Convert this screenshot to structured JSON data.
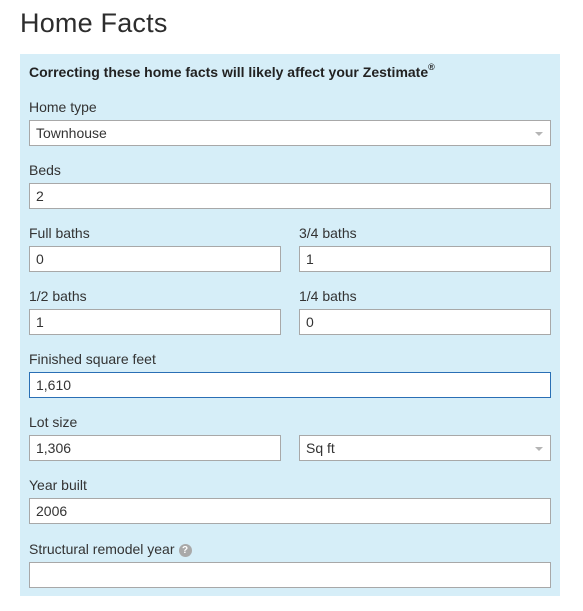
{
  "title": "Home Facts",
  "notice": {
    "text": "Correcting these home facts will likely affect your Zestimate",
    "mark": "®"
  },
  "fields": {
    "home_type": {
      "label": "Home type",
      "value": "Townhouse"
    },
    "beds": {
      "label": "Beds",
      "value": "2"
    },
    "full_baths": {
      "label": "Full baths",
      "value": "0"
    },
    "three_quarter_baths": {
      "label": "3/4 baths",
      "value": "1"
    },
    "half_baths": {
      "label": "1/2 baths",
      "value": "1"
    },
    "quarter_baths": {
      "label": "1/4 baths",
      "value": "0"
    },
    "finished_sqft": {
      "label": "Finished square feet",
      "value": "1,610"
    },
    "lot_size": {
      "label": "Lot size",
      "value": "1,306"
    },
    "lot_unit": {
      "value": "Sq ft"
    },
    "year_built": {
      "label": "Year built",
      "value": "2006"
    },
    "remodel_year": {
      "label": "Structural remodel year",
      "value": "",
      "help_icon": "question-icon",
      "help_glyph": "?"
    }
  },
  "colors": {
    "panel_bg": "#d6eef8",
    "focus_border": "#2a6fb5"
  }
}
